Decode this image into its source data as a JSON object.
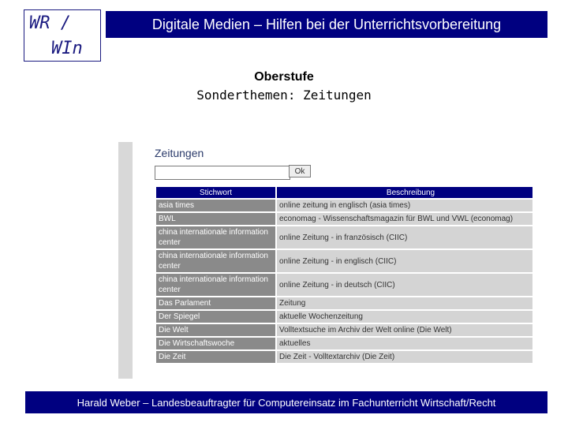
{
  "logo": {
    "line1": "WR /",
    "line2": "WIn"
  },
  "header": {
    "title": "Digitale Medien – Hilfen bei der Unterrichtsvorbereitung"
  },
  "subtitle": {
    "level": "Oberstufe",
    "topic": "Sonderthemen: Zeitungen"
  },
  "screenshot": {
    "heading": "Zeitungen",
    "search_value": "",
    "ok_label": "Ok",
    "columns": [
      "Stichwort",
      "Beschreibung"
    ],
    "rows": [
      [
        "asia times",
        "online zeitung in englisch (asia times)"
      ],
      [
        "BWL",
        "economag - Wissenschaftsmagazin für BWL und VWL (economag)"
      ],
      [
        "china internationale information center",
        "online Zeitung - in französisch (CIIC)"
      ],
      [
        "china internationale information center",
        "online Zeitung - in englisch (CIIC)"
      ],
      [
        "china internationale information center",
        "online Zeitung - in deutsch (CIIC)"
      ],
      [
        "Das Parlament",
        "Zeitung"
      ],
      [
        "Der Spiegel",
        "aktuelle Wochenzeitung"
      ],
      [
        "Die Welt",
        "Volltextsuche im Archiv der Welt online (Die Welt)"
      ],
      [
        "Die Wirtschaftswoche",
        "aktuelles"
      ],
      [
        "Die Zeit",
        "Die Zeit - Volltextarchiv (Die Zeit)"
      ]
    ]
  },
  "footer": {
    "text": "Harald Weber – Landesbeauftragter für Computereinsatz im Fachunterricht Wirtschaft/Recht"
  }
}
